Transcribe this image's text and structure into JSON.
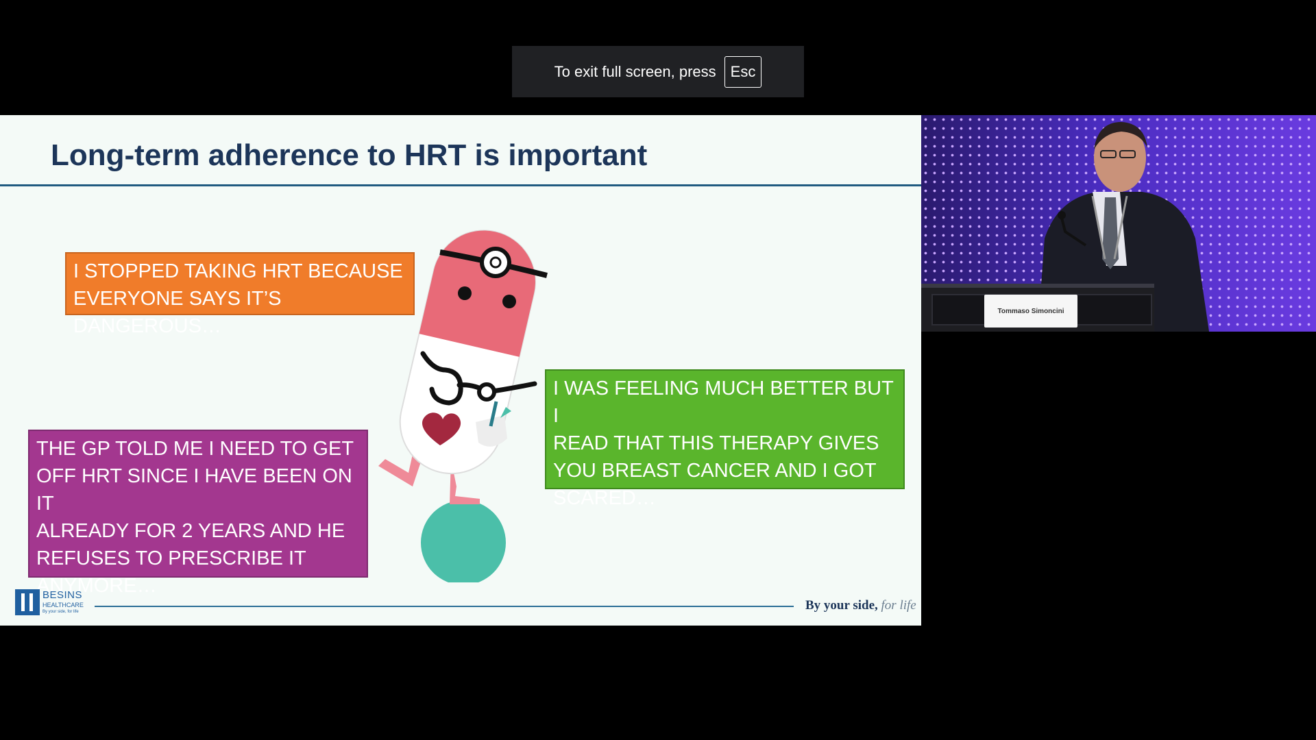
{
  "fullscreen_notice": {
    "message": "To exit full screen, press",
    "key": "Esc"
  },
  "slide": {
    "title": "Long-term adherence to HRT is important",
    "quotes": [
      {
        "text": "I STOPPED TAKING HRT BECAUSE\nEVERYONE SAYS IT’S DANGEROUS…",
        "color": "#f07c2a"
      },
      {
        "text": "THE GP TOLD ME I NEED TO GET\nOFF HRT SINCE I HAVE BEEN ON IT\nALREADY FOR 2 YEARS AND HE\nREFUSES TO PRESCRIBE IT\nANYMORE…",
        "color": "#a3378f"
      },
      {
        "text": "I WAS FEELING MUCH BETTER BUT I\nREAD THAT THIS THERAPY GIVES\nYOU BREAST CANCER AND I GOT\nSCARED…",
        "color": "#5ab52c"
      }
    ],
    "footer": {
      "logo_brand": "BESINS",
      "logo_sub": "HEALTHCARE",
      "logo_tagline": "By your side, for life",
      "tagline_main": "By your side,",
      "tagline_script": "for life"
    }
  },
  "video": {
    "speaker_nameplate": "Tommaso Simoncini"
  },
  "colors": {
    "title": "#1c3559",
    "slide_bg": "#f4faf7",
    "pill_top": "#e86a78",
    "ball": "#4bbfa9"
  }
}
